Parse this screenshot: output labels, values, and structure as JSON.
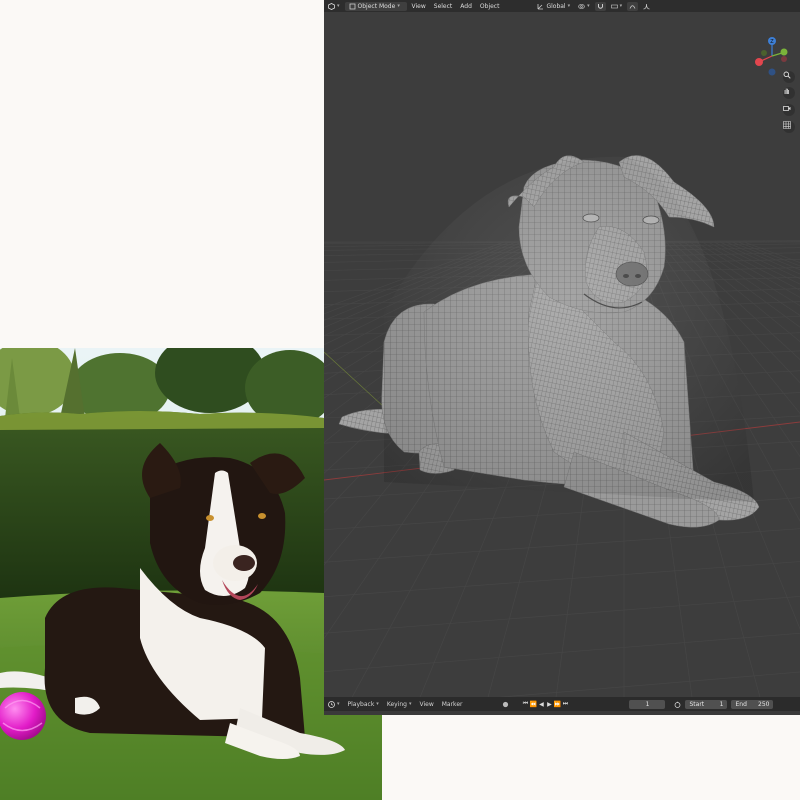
{
  "header": {
    "mode_label": "Object Mode",
    "menus": [
      "View",
      "Select",
      "Add",
      "Object"
    ],
    "orientation_label": "Global"
  },
  "gizmo": {
    "z_label": "Z",
    "x_color": "#e2464e",
    "y_color": "#7ab33a",
    "z_color": "#3d7fd6"
  },
  "viewport_tools": [
    "zoom-icon",
    "hand-pan-icon",
    "camera-icon",
    "grid-icon"
  ],
  "timeline": {
    "menus": [
      "Playback",
      "Keying",
      "View",
      "Marker"
    ],
    "current_frame": "1",
    "start_label": "Start",
    "start_value": "1",
    "end_label": "End",
    "end_value": "250"
  },
  "colors": {
    "viewport_bg": "#3d3d3d",
    "header_bg": "#2d2d2d",
    "page_bg": "#fbf9f6",
    "wire": "#d8d8d8",
    "x_axis_line": "#9a3c3c"
  }
}
